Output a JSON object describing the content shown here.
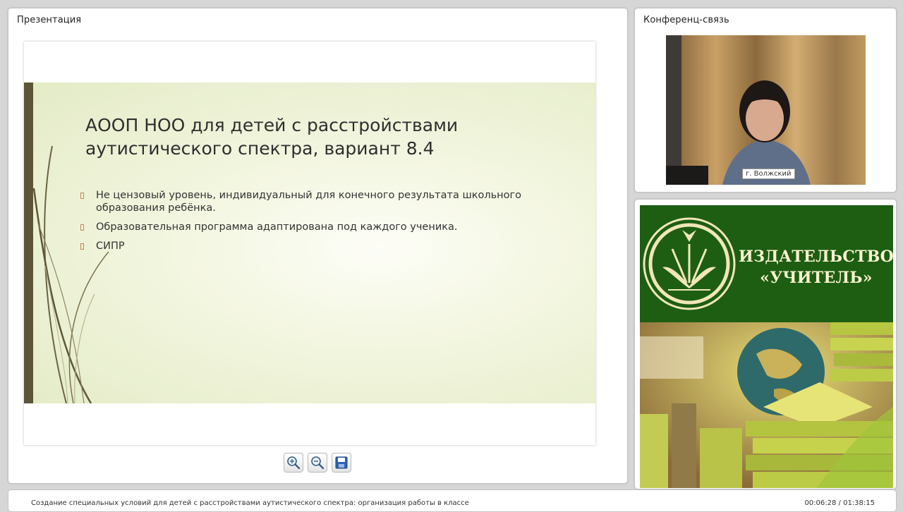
{
  "presentation_panel": {
    "title": "Презентация",
    "slide": {
      "heading_line1": "АООП НОО для детей с расстройствами",
      "heading_line2": "аутистического спектра, вариант 8.4",
      "bullets": [
        "Не цензовый уровень, индивидуальный для конечного результата школьного образования ребёнка.",
        "Образовательная программа адаптирована под каждого ученика.",
        " СИПР"
      ]
    },
    "toolbar": {
      "zoom_in_icon": "zoom-in-icon",
      "zoom_out_icon": "zoom-out-icon",
      "save_icon": "floppy-disk-icon"
    }
  },
  "conference_panel": {
    "title": "Конференц-связь",
    "video_label": "г. Волжский"
  },
  "publisher": {
    "name_line1": "ИЗДАТЕЛЬСТВО",
    "name_line2": "«УЧИТЕЛЬ»"
  },
  "status_bar": {
    "webinar_title": "Создание специальных условий для детей с расстройствами аутистического спектра: организация работы в классе",
    "time": "00:06:28 / 01:38:15"
  },
  "colors": {
    "page_bg": "#d6d6d6",
    "publisher_green": "#1d5e13",
    "slide_stripe": "#5d5537"
  }
}
